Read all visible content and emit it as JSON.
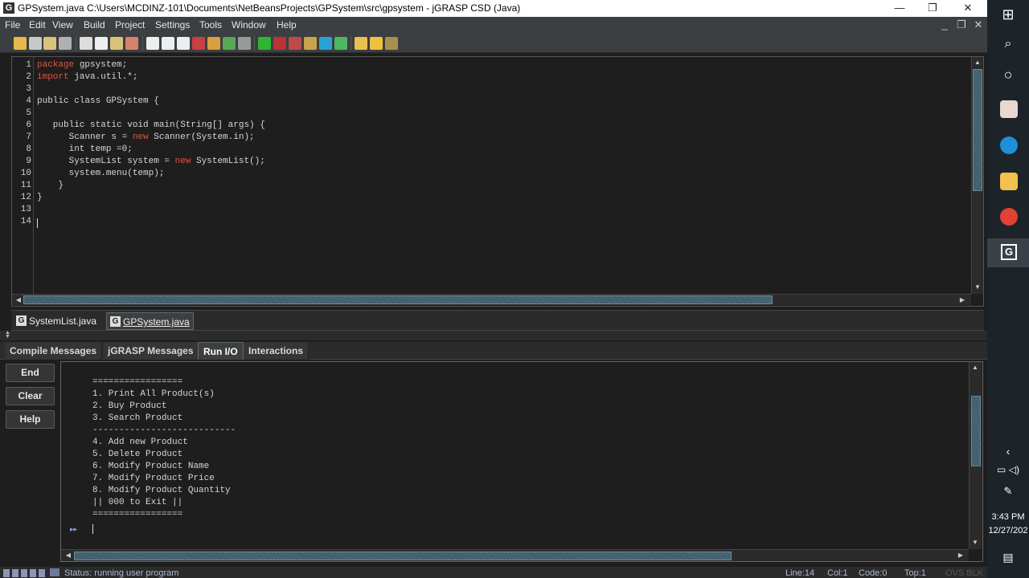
{
  "window": {
    "title": "GPSystem.java  C:\\Users\\MCDINZ-101\\Documents\\NetBeansProjects\\GPSystem\\src\\gpsystem - jGRASP CSD (Java)",
    "app_icon": "G",
    "minimize": "—",
    "maximize": "❐",
    "close": "✕"
  },
  "menu": [
    "File",
    "Edit",
    "View",
    "Build",
    "Project",
    "Settings",
    "Tools",
    "Window",
    "Help"
  ],
  "editor": {
    "lines": [
      {
        "n": "1",
        "parts": [
          {
            "t": "package",
            "k": true
          },
          {
            "t": " gpsystem;"
          }
        ]
      },
      {
        "n": "2",
        "parts": [
          {
            "t": "import",
            "k": true
          },
          {
            "t": " java.util.*;"
          }
        ]
      },
      {
        "n": "3",
        "parts": []
      },
      {
        "n": "4",
        "parts": [
          {
            "t": "public class GPSystem {"
          }
        ]
      },
      {
        "n": "5",
        "parts": []
      },
      {
        "n": "6",
        "parts": [
          {
            "t": "   public static void main(String[] args) {"
          }
        ]
      },
      {
        "n": "7",
        "parts": [
          {
            "t": "      Scanner s = "
          },
          {
            "t": "new",
            "k": true
          },
          {
            "t": " Scanner(System.in);"
          }
        ]
      },
      {
        "n": "8",
        "parts": [
          {
            "t": "      int temp =0;"
          }
        ]
      },
      {
        "n": "9",
        "parts": [
          {
            "t": "      SystemList system = "
          },
          {
            "t": "new",
            "k": true
          },
          {
            "t": " SystemList();"
          }
        ]
      },
      {
        "n": "10",
        "parts": [
          {
            "t": "      system.menu(temp);"
          }
        ]
      },
      {
        "n": "11",
        "parts": [
          {
            "t": "    }"
          }
        ]
      },
      {
        "n": "12",
        "parts": [
          {
            "t": "}"
          }
        ]
      },
      {
        "n": "13",
        "parts": []
      },
      {
        "n": "14",
        "parts": []
      }
    ]
  },
  "file_tabs": [
    {
      "label": "SystemList.java",
      "active": false
    },
    {
      "label": "GPSystem.java",
      "active": true
    }
  ],
  "message_tabs": [
    {
      "label": "Compile Messages",
      "active": false
    },
    {
      "label": "jGRASP Messages",
      "active": false
    },
    {
      "label": "Run I/O",
      "active": true
    },
    {
      "label": "Interactions",
      "active": false
    }
  ],
  "side_buttons": [
    "End",
    "Clear",
    "Help"
  ],
  "run_io": {
    "output_lines": [
      "=================",
      "1. Print All Product(s)",
      "2. Buy Product",
      "3. Search Product",
      "---------------------------",
      "4. Add new Product",
      "5. Delete Product",
      "6. Modify Product Name",
      "7. Modify Product Price",
      "8. Modify Product Quantity",
      "|| 000 to Exit ||",
      "================="
    ],
    "prompt_marker": "▸▸"
  },
  "status": {
    "text": "Status: running user program",
    "line": "Line:14",
    "col": "Col:1",
    "code": "Code:0",
    "top": "Top:1",
    "ovs": "OVS BLK"
  },
  "taskbar": {
    "time": "3:43 PM",
    "date": "12/27/202",
    "colors": {
      "edge": "#1f8fd6",
      "chrome": "#e34133",
      "explorer": "#f2c14e"
    }
  }
}
